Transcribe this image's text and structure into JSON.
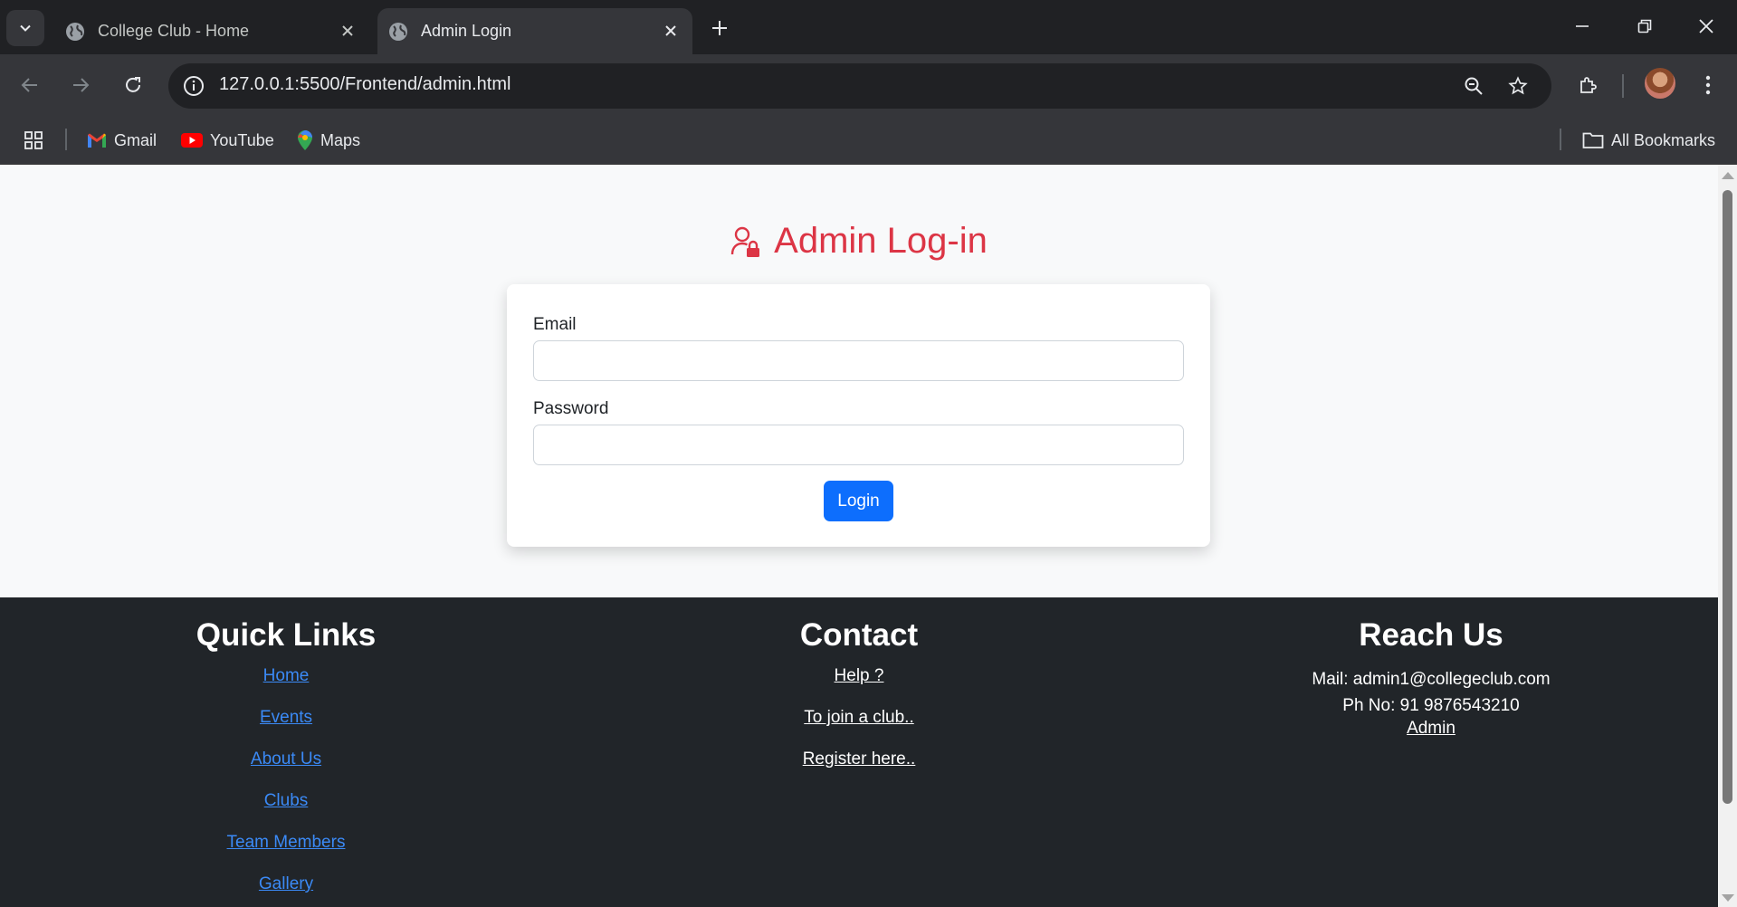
{
  "browser": {
    "tabs": [
      {
        "title": "College Club - Home",
        "active": false
      },
      {
        "title": "Admin Login",
        "active": true
      }
    ],
    "url_host": "127.0.0.1",
    "url_path": ":5500/Frontend/admin.html",
    "bookmarks": [
      {
        "label": "Gmail",
        "icon": "gmail-icon"
      },
      {
        "label": "YouTube",
        "icon": "youtube-icon"
      },
      {
        "label": "Maps",
        "icon": "maps-icon"
      }
    ],
    "all_bookmarks": "All Bookmarks"
  },
  "page": {
    "title": "Admin Log-in",
    "title_color": "#dc3545",
    "form": {
      "email_label": "Email",
      "email_value": "",
      "password_label": "Password",
      "password_value": "",
      "login_label": "Login",
      "accent": "#0d6efd"
    }
  },
  "footer": {
    "quick_links": {
      "heading": "Quick Links",
      "items": [
        "Home",
        "Events",
        "About Us",
        "Clubs",
        "Team Members",
        "Gallery"
      ]
    },
    "contact": {
      "heading": "Contact",
      "items": [
        "Help ?",
        "To join a club..",
        "Register here.."
      ]
    },
    "reach_us": {
      "heading": "Reach Us",
      "mail": "Mail: admin1@collegeclub.com",
      "phone": "Ph No: 91 9876543210",
      "admin_link": "Admin"
    }
  }
}
